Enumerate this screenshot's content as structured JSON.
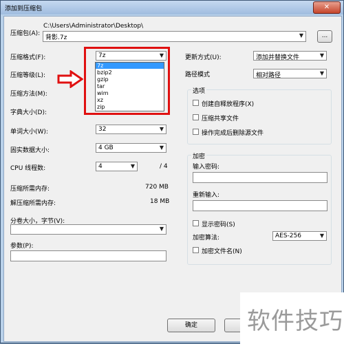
{
  "window": {
    "title": "添加到压缩包",
    "close_glyph": "✕"
  },
  "archive": {
    "label": "压缩包(A):",
    "path": "C:\\Users\\Administrator\\Desktop\\",
    "filename": "背影.7z",
    "browse_label": "..."
  },
  "left": {
    "format_label": "压缩格式(F):",
    "format_value": "7z",
    "level_label": "压缩等级(L):",
    "method_label": "压缩方法(M):",
    "dict_label": "字典大小(D):",
    "word_label": "单词大小(W):",
    "word_value": "32",
    "solid_label": "固实数据大小:",
    "solid_value": "4 GB",
    "cpu_label": "CPU 线程数:",
    "cpu_value": "4",
    "cpu_total": "/ 4",
    "mem_comp_label": "压缩所需内存:",
    "mem_comp_value": "720 MB",
    "mem_decomp_label": "解压缩所需内存:",
    "mem_decomp_value": "18 MB",
    "split_label": "分卷大小，字节(V):",
    "params_label": "参数(P):"
  },
  "format_options": [
    "7z",
    "bzip2",
    "gzip",
    "tar",
    "wim",
    "xz",
    "zip"
  ],
  "right": {
    "update_label": "更新方式(U):",
    "update_value": "添加并替换文件",
    "path_label": "路径模式",
    "path_value": "相对路径",
    "options_title": "选项",
    "opt_sfx": "创建自释放程序(X)",
    "opt_shared": "压缩共享文件",
    "opt_delete": "操作完成后删除源文件",
    "enc_title": "加密",
    "enc_pwd_label": "输入密码:",
    "enc_repeat_label": "重新输入:",
    "enc_show": "显示密码(S)",
    "enc_method_label": "加密算法:",
    "enc_method_value": "AES-256",
    "enc_names": "加密文件名(N)"
  },
  "buttons": {
    "ok": "确定"
  },
  "watermark": "软件技巧",
  "colors": {
    "highlight": "#e01010",
    "selection": "#3399ff"
  }
}
